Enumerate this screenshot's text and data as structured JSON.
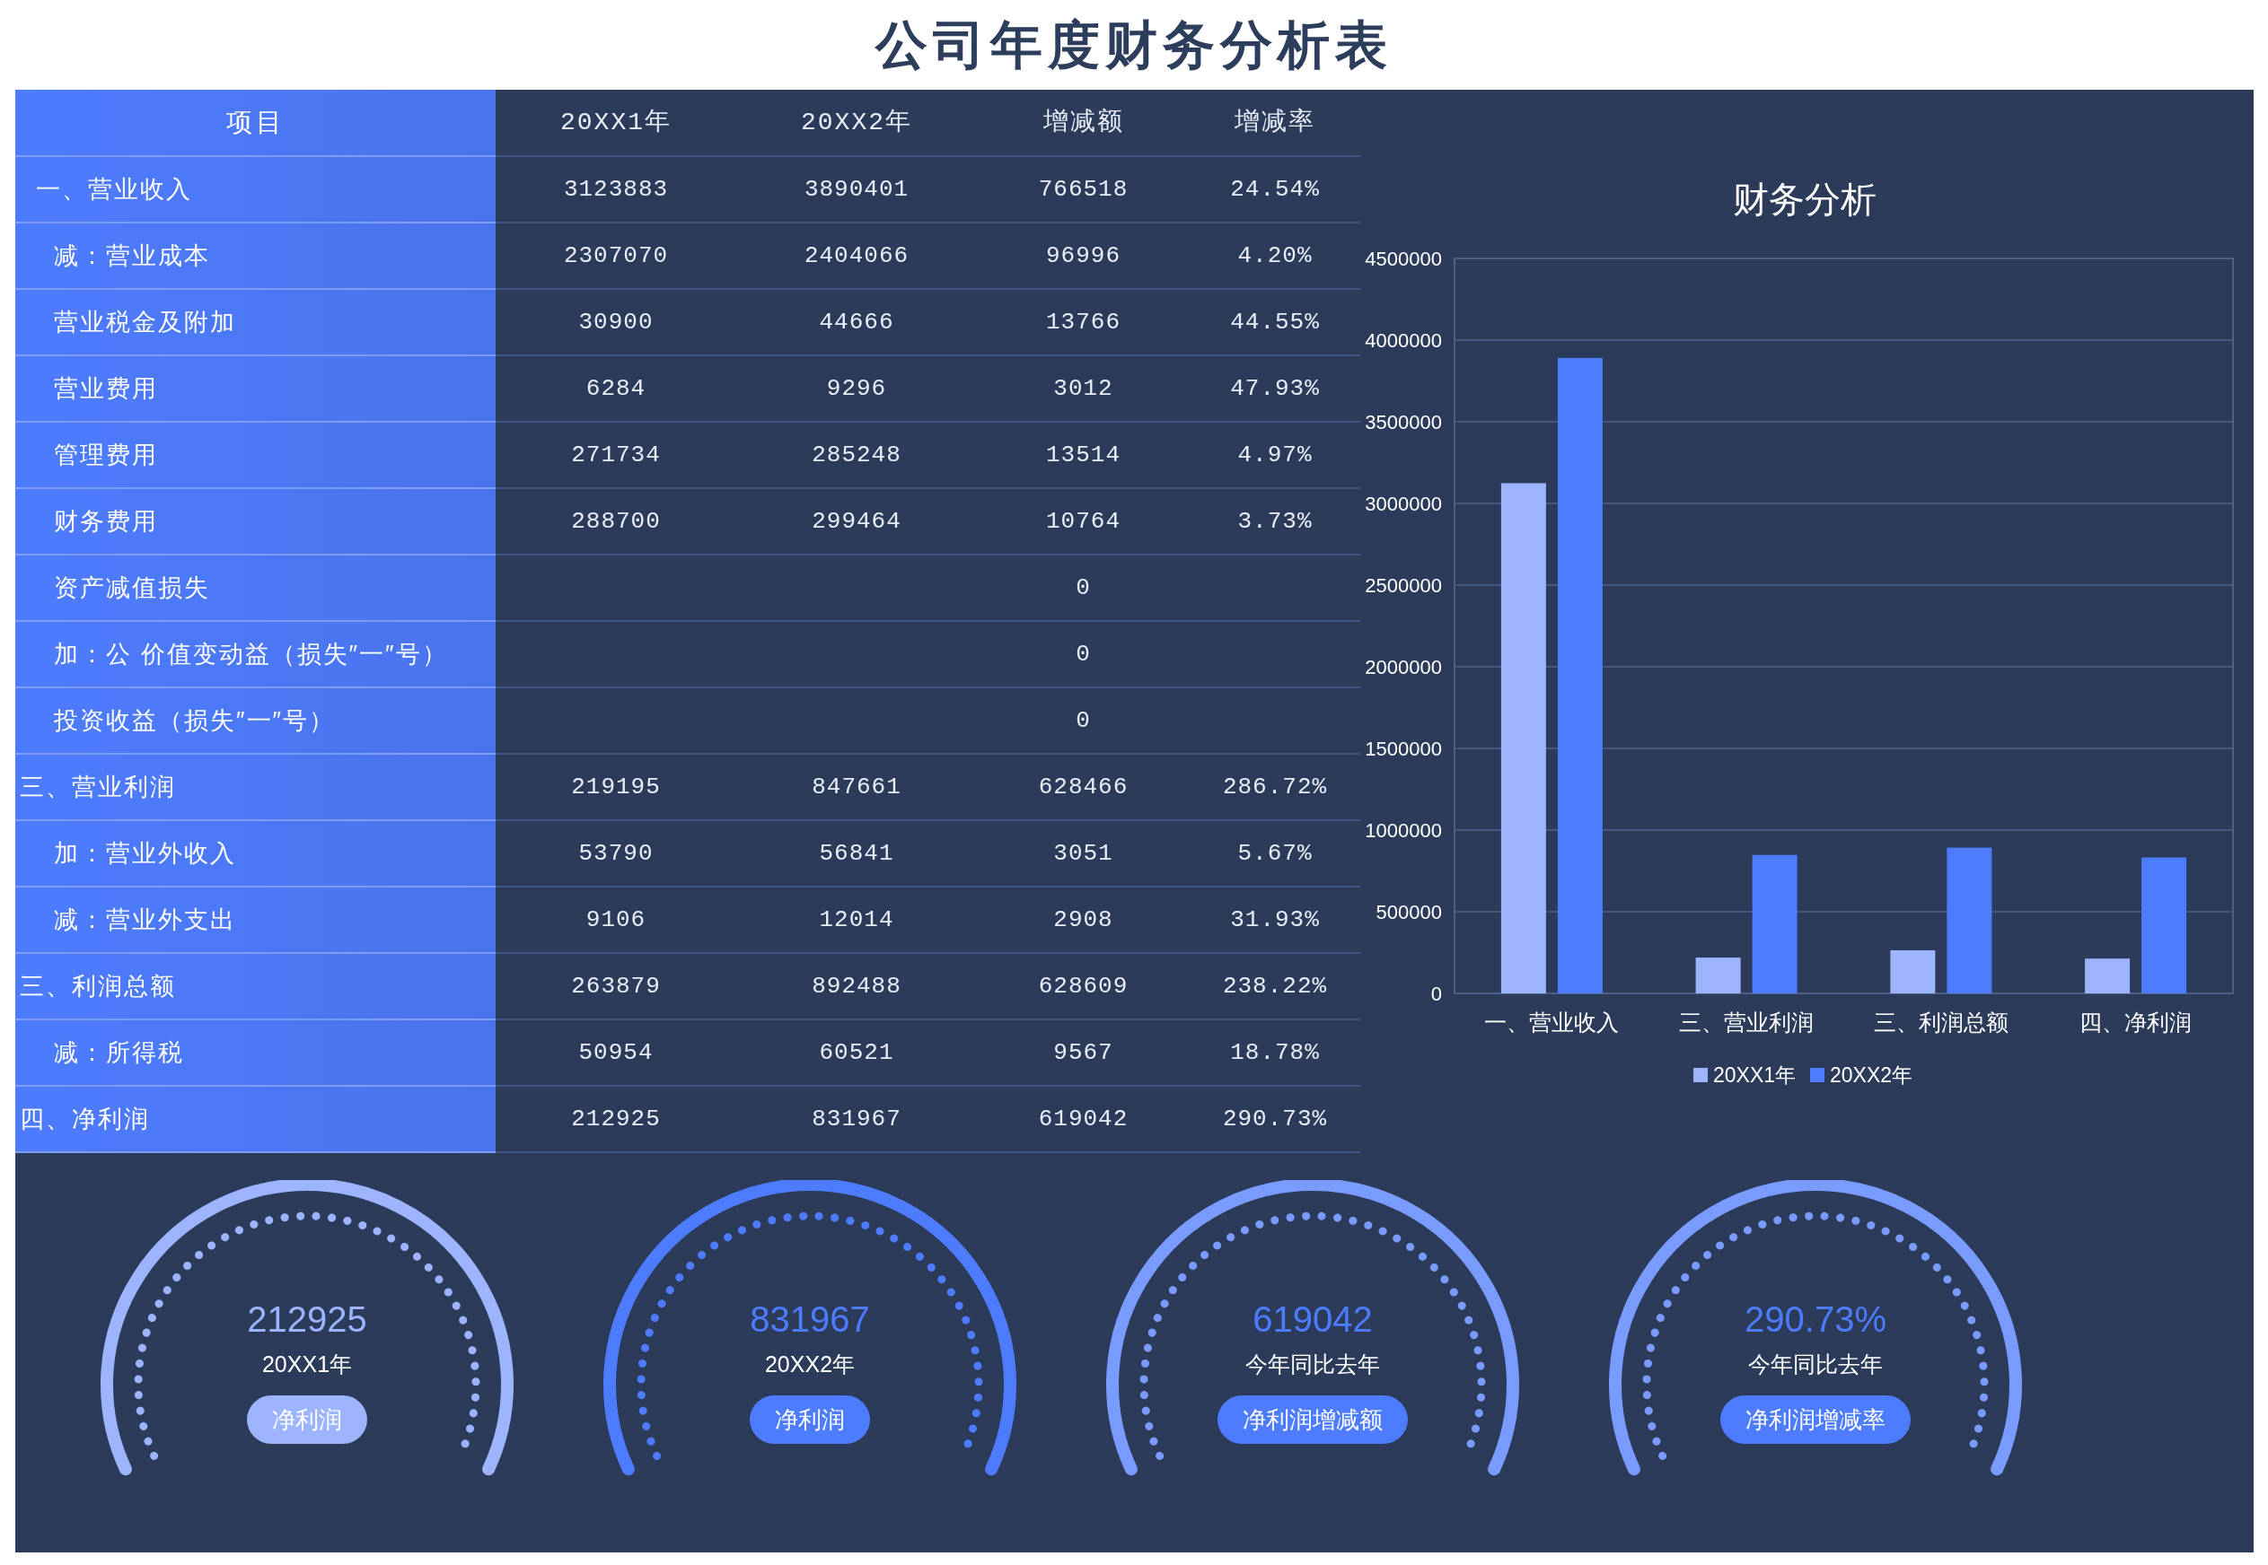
{
  "title": "公司年度财务分析表",
  "table": {
    "columns": [
      "项目",
      "20XX1年",
      "20XX2年",
      "增减额",
      "增减率"
    ],
    "rows": [
      {
        "label": "一、营业收入",
        "kind": "top",
        "values": [
          "3123883",
          "3890401",
          "766518",
          "24.54%"
        ]
      },
      {
        "label": "减：营业成本",
        "kind": "item",
        "values": [
          "2307070",
          "2404066",
          "96996",
          "4.20%"
        ]
      },
      {
        "label": "营业税金及附加",
        "kind": "item",
        "values": [
          "30900",
          "44666",
          "13766",
          "44.55%"
        ]
      },
      {
        "label": "营业费用",
        "kind": "item",
        "values": [
          "6284",
          "9296",
          "3012",
          "47.93%"
        ]
      },
      {
        "label": "管理费用",
        "kind": "item",
        "values": [
          "271734",
          "285248",
          "13514",
          "4.97%"
        ]
      },
      {
        "label": "财务费用",
        "kind": "item",
        "values": [
          "288700",
          "299464",
          "10764",
          "3.73%"
        ]
      },
      {
        "label": "资产减值损失",
        "kind": "item",
        "values": {
          "change": "0"
        }
      },
      {
        "label": "加：公  价值变动益（损失″一″号）",
        "kind": "item",
        "values": {
          "change": "0"
        }
      },
      {
        "label": "投资收益（损失″一″号）",
        "kind": "item",
        "values": {
          "change": "0"
        }
      },
      {
        "label": "三、营业利润",
        "kind": "total",
        "values": [
          "219195",
          "847661",
          "628466",
          "286.72%"
        ]
      },
      {
        "label": "加：营业外收入",
        "kind": "item",
        "values": [
          "53790",
          "56841",
          "3051",
          "5.67%"
        ]
      },
      {
        "label": "减：营业外支出",
        "kind": "item",
        "values": [
          "9106",
          "12014",
          "2908",
          "31.93%"
        ]
      },
      {
        "label": "三、利润总额",
        "kind": "total",
        "values": [
          "263879",
          "892488",
          "628609",
          "238.22%"
        ]
      },
      {
        "label": "减：所得税",
        "kind": "item",
        "values": [
          "50954",
          "60521",
          "9567",
          "18.78%"
        ]
      },
      {
        "label": "四、净利润",
        "kind": "total",
        "values": [
          "212925",
          "831967",
          "619042",
          "290.73%"
        ]
      }
    ]
  },
  "chart": {
    "chart_data": {
      "type": "bar",
      "title": "财务分析",
      "categories": [
        "一、营业收入",
        "三、营业利润",
        "三、利润总额",
        "四、净利润"
      ],
      "series": [
        {
          "name": "20XX1年",
          "color": "#9db5ff",
          "values": [
            3123883,
            219195,
            263879,
            212925
          ]
        },
        {
          "name": "20XX2年",
          "color": "#4d7cfe",
          "values": [
            3890401,
            847661,
            892488,
            831967
          ]
        }
      ],
      "grid": true,
      "legend": true,
      "ylim": [
        0,
        4500000
      ],
      "yticks": [
        0,
        500000,
        1000000,
        1500000,
        2000000,
        2500000,
        3000000,
        3500000,
        4000000,
        4500000
      ]
    }
  },
  "gauges": [
    {
      "color": "#9db5ff",
      "value": {
        "text": "212925",
        "color": "#9db5ff"
      },
      "label": "20XX1年",
      "tag": {
        "text": "净利润",
        "color": "#9db5ff"
      }
    },
    {
      "color": "#4d7cfe",
      "value": {
        "text": "831967",
        "color": "#4d7cfe"
      },
      "label": "20XX2年",
      "tag": {
        "text": "净利润",
        "color": "#4d7cfe"
      }
    },
    {
      "color": "#7a9bff",
      "value": {
        "text": "619042",
        "color": "#4d7cfe"
      },
      "label": "今年同比去年",
      "tag": {
        "text": "净利润增减额",
        "color": "#4d7cfe"
      }
    },
    {
      "color": "#7a9bff",
      "value": {
        "text": "290.73%",
        "color": "#4d7cfe"
      },
      "label": "今年同比去年",
      "tag": {
        "text": "净利润增减率",
        "color": "#4d7cfe"
      }
    }
  ]
}
